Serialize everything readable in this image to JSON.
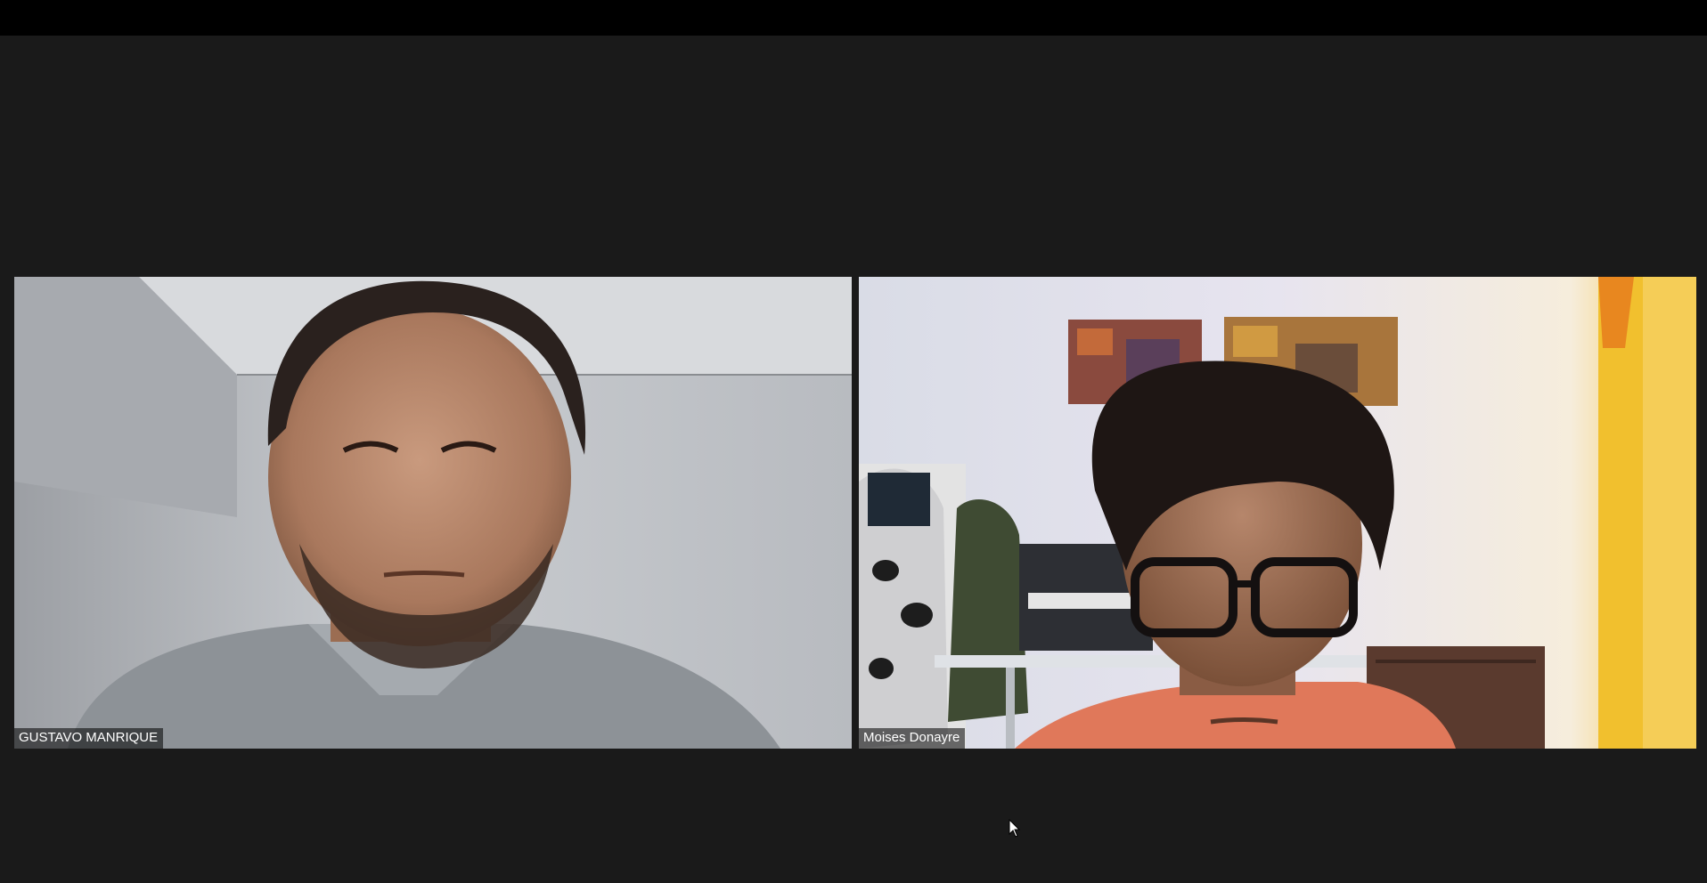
{
  "meeting": {
    "participants": [
      {
        "name": "GUSTAVO MANRIQUE"
      },
      {
        "name": "Moises Donayre"
      }
    ]
  },
  "colors": {
    "background": "#1a1a1a",
    "top_bar": "#000000",
    "label_background": "rgba(0,0,0,0.55)",
    "label_text": "#ffffff"
  },
  "icons": {
    "cursor": "mouse-pointer-icon"
  }
}
